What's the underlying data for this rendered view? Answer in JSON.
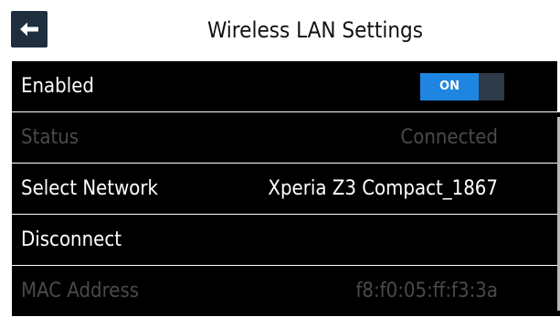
{
  "header": {
    "title": "Wireless LAN Settings",
    "back_icon": "arrow-left-icon"
  },
  "rows": [
    {
      "label": "Enabled",
      "toggle": {
        "label": "ON",
        "state": true,
        "accent": "#1e86e0"
      }
    },
    {
      "label": "Status",
      "value": "Connected",
      "disabled": true
    },
    {
      "label": "Select Network",
      "value": "Xperia Z3 Compact_1867"
    },
    {
      "label": "Disconnect"
    },
    {
      "label": "MAC Address",
      "value": "f8:f0:05:ff:f3:3a",
      "disabled": true
    }
  ]
}
